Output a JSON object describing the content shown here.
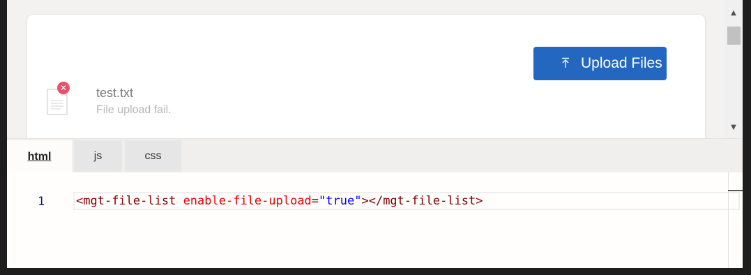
{
  "preview": {
    "upload_button": {
      "label": "Upload Files",
      "icon": "upload-icon"
    },
    "file": {
      "name": "test.txt",
      "status": "File upload fail.",
      "icon": "text-file-icon",
      "badge_icon": "error-x-icon"
    }
  },
  "tabs": [
    {
      "label": "html",
      "active": true
    },
    {
      "label": "js",
      "active": false
    },
    {
      "label": "css",
      "active": false
    }
  ],
  "editor": {
    "line_number": "1",
    "tokens": {
      "open_bracket": "<",
      "tag_open": "mgt-file-list",
      "attr": "enable-file-upload",
      "eq": "=",
      "value": "\"true\"",
      "close_open": "></",
      "tag_close": "mgt-file-list",
      "end": ">"
    }
  },
  "colors": {
    "accent": "#2367c0",
    "error": "#e8506b"
  }
}
